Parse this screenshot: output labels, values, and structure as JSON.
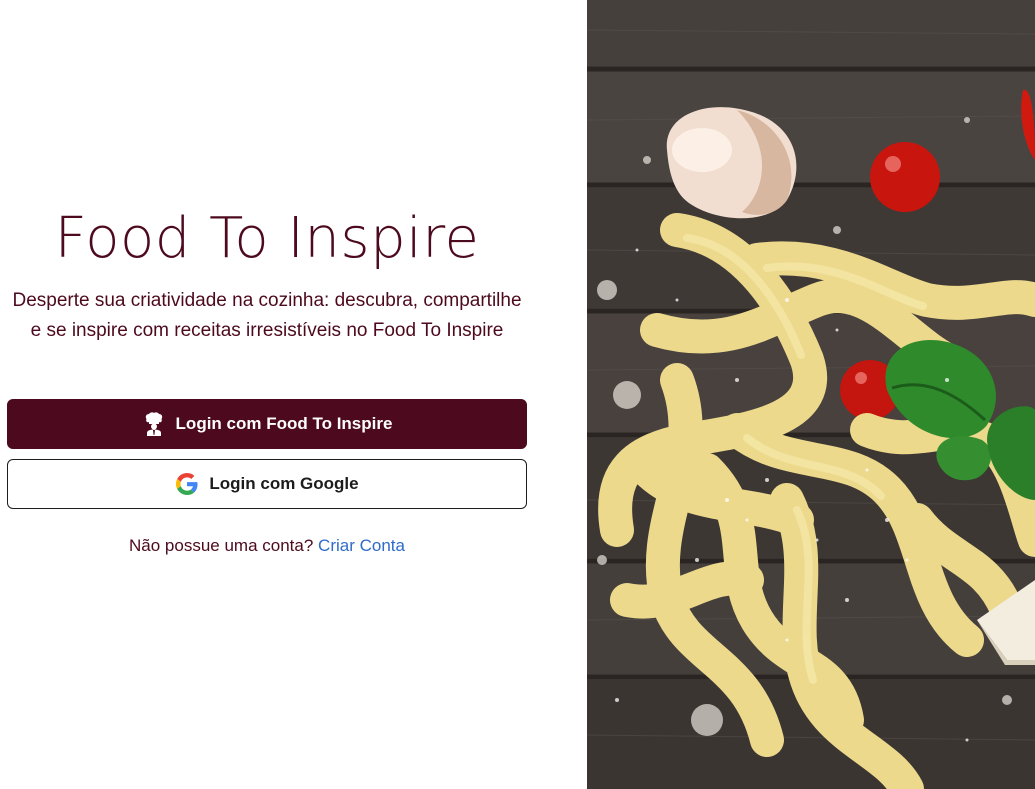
{
  "app": {
    "title": "Food To Inspire",
    "subtitle": "Desperte sua criatividade na cozinha: descubra, compartilhe e se inspire com receitas irresistíveis no Food To Inspire"
  },
  "buttons": {
    "login_app_label": "Login com Food To Inspire",
    "login_app_icon": "chef-icon",
    "login_google_label": "Login com Google",
    "login_google_icon": "google-icon"
  },
  "signup": {
    "prompt": "Não possue uma conta?",
    "link_label": "Criar Conta"
  },
  "hero_image": {
    "icon": "food-photo"
  },
  "colors": {
    "brand": "#4d0a1e",
    "link": "#2f6bc9",
    "background": "#ffffff"
  }
}
